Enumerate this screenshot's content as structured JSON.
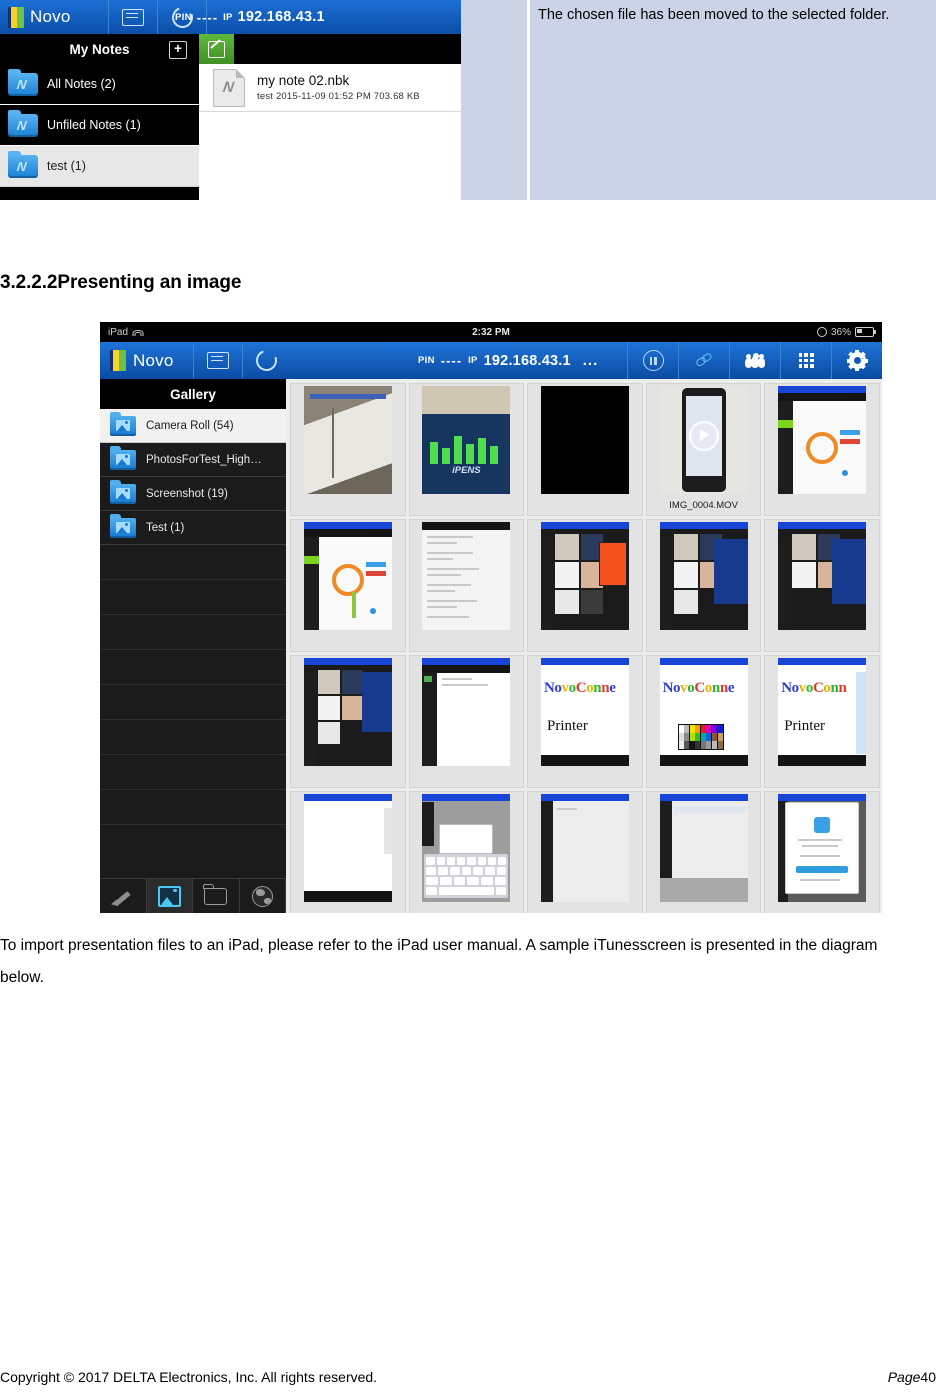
{
  "notes_figure": {
    "toolbar": {
      "app_name": "Novo",
      "pin_label": "PIN",
      "pin_value": "----",
      "ip_label": "IP",
      "ip_value": "192.168.43.1",
      "cast_icon": "cast-icon",
      "refresh_icon": "refresh-icon"
    },
    "sidebar": {
      "title": "My Notes",
      "add_label": "+",
      "items": [
        {
          "label": "All Notes (2)",
          "selected": false
        },
        {
          "label": "Unfiled Notes (1)",
          "selected": false
        },
        {
          "label": "test (1)",
          "selected": true
        }
      ]
    },
    "main": {
      "new_note_icon": "edit-note-icon",
      "file": {
        "name": "my note 02.nbk",
        "meta": "test   2015-11-09 01:52 PM   703.68 KB"
      }
    }
  },
  "caption_cell": {
    "text": "The chosen file has been moved to the selected folder."
  },
  "heading": {
    "number": "3.2.2.2",
    "title": "Presenting an image"
  },
  "gallery_figure": {
    "status_bar": {
      "device": "iPad",
      "wifi_icon": "wifi-icon",
      "time": "2:32 PM",
      "battery_percent": "36%",
      "battery_icon": "battery-icon",
      "charging_icon": "charging-icon"
    },
    "toolbar": {
      "app_name": "Novo",
      "cast_icon": "cast-icon",
      "refresh_icon": "refresh-icon",
      "pin_label": "PIN",
      "pin_value": "----",
      "ip_label": "IP",
      "ip_value": "192.168.43.1",
      "overflow": "...",
      "actions": [
        {
          "name": "pause-icon"
        },
        {
          "name": "link-icon"
        },
        {
          "name": "participants-icon"
        },
        {
          "name": "apps-grid-icon"
        },
        {
          "name": "settings-gear-icon"
        }
      ]
    },
    "sidebar": {
      "title": "Gallery",
      "albums": [
        {
          "label": "Camera Roll (54)",
          "selected": true
        },
        {
          "label": "PhotosForTest_High…",
          "selected": false
        },
        {
          "label": "Screenshot (19)",
          "selected": false
        },
        {
          "label": "Test (1)",
          "selected": false
        }
      ],
      "footer_tabs": [
        {
          "name": "whiteboard-pen-icon",
          "active": false
        },
        {
          "name": "photo-gallery-icon",
          "active": true
        },
        {
          "name": "file-folder-icon",
          "active": false
        },
        {
          "name": "web-browser-icon",
          "active": false
        }
      ]
    },
    "grid": {
      "video_caption": "IMG_0004.MOV",
      "handwriting_line1": "NovoConne",
      "handwriting_line2": "Printer",
      "handwriting_short1": "NovoConn",
      "items": [
        {
          "kind": "photo-whiteboard"
        },
        {
          "kind": "photo-ipens-booth"
        },
        {
          "kind": "photo-dark"
        },
        {
          "kind": "video-thumbnail"
        },
        {
          "kind": "screenshot-dashboard"
        },
        {
          "kind": "screenshot-dashboard"
        },
        {
          "kind": "screenshot-list"
        },
        {
          "kind": "screenshot-gallery-orange"
        },
        {
          "kind": "screenshot-gallery-dialog"
        },
        {
          "kind": "screenshot-gallery-dialog"
        },
        {
          "kind": "screenshot-gallery-panel"
        },
        {
          "kind": "screenshot-blank-doc"
        },
        {
          "kind": "whiteboard-writing"
        },
        {
          "kind": "whiteboard-palette"
        },
        {
          "kind": "whiteboard-writing-side"
        },
        {
          "kind": "screenshot-white-page"
        },
        {
          "kind": "screenshot-keyboard"
        },
        {
          "kind": "screenshot-grey-page"
        },
        {
          "kind": "screenshot-note-bar"
        },
        {
          "kind": "screenshot-pages-dialog"
        }
      ]
    }
  },
  "paragraph": {
    "text": "To import presentation files to an iPad, please refer to the iPad user manual. A sample iTunesscreen is presented in the diagram below."
  },
  "footer": {
    "copyright": "Copyright © 2017 DELTA Electronics, Inc. All rights reserved.",
    "page_label": "Page",
    "page_number": "40"
  }
}
